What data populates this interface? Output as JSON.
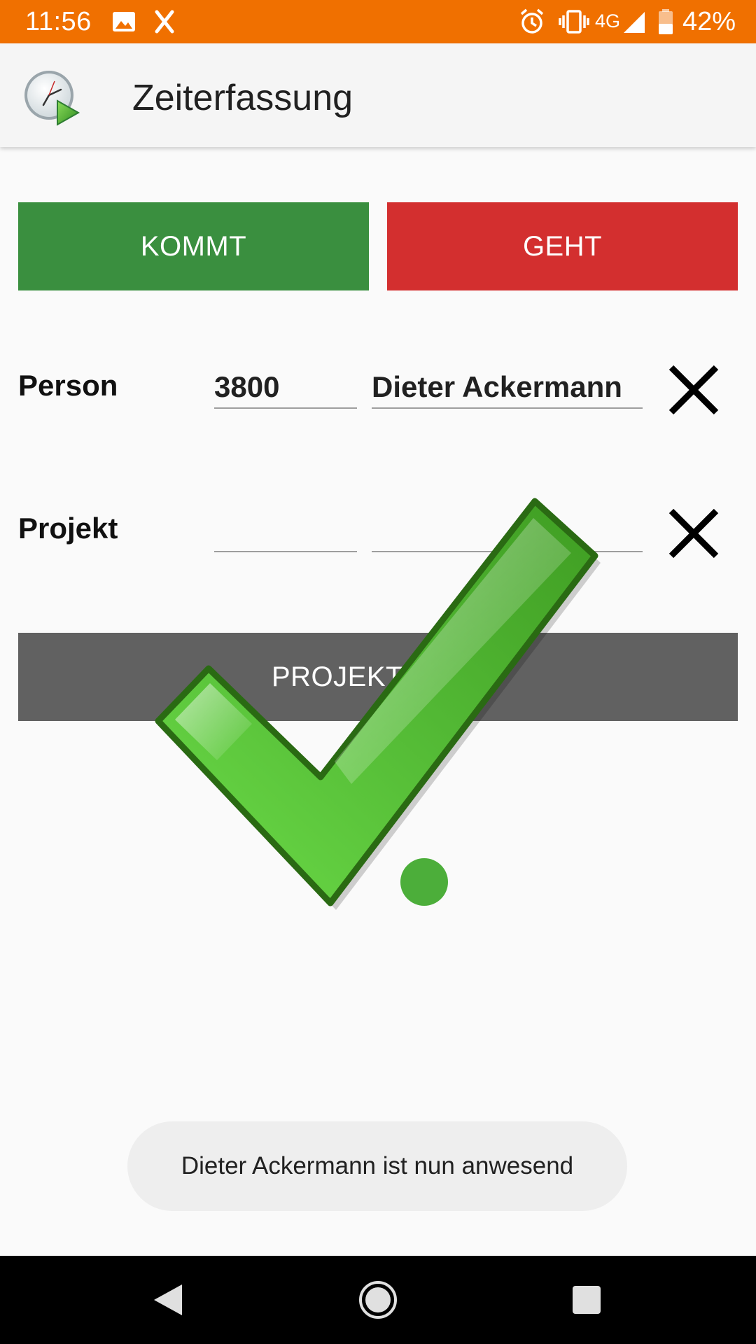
{
  "status_bar": {
    "time": "11:56",
    "network": "4G",
    "battery": "42%",
    "icons": [
      "image-icon",
      "x-app-icon",
      "alarm-icon",
      "vibrate-icon",
      "signal-icon",
      "battery-icon"
    ],
    "background": "#f07000"
  },
  "app_bar": {
    "title": "Zeiterfassung",
    "logo": "clock-play-icon"
  },
  "actions": {
    "kommt_label": "KOMMT",
    "geht_label": "GEHT",
    "kommt_color": "#3a8f3f",
    "geht_color": "#d32f2f"
  },
  "person": {
    "label": "Person",
    "id": "3800",
    "name": "Dieter Ackermann",
    "clear_icon": "close-icon"
  },
  "project": {
    "label": "Projekt",
    "id": "",
    "name": "",
    "clear_icon": "close-icon"
  },
  "project_button": {
    "label": "PROJEKTWAHL",
    "color": "#616161"
  },
  "overlay": {
    "icon": "checkmark-icon",
    "color": "#4caf50"
  },
  "toast": {
    "message": "Dieter Ackermann ist nun anwesend"
  },
  "nav_bar": {
    "icons": [
      "back-icon",
      "home-icon",
      "recents-icon"
    ]
  }
}
